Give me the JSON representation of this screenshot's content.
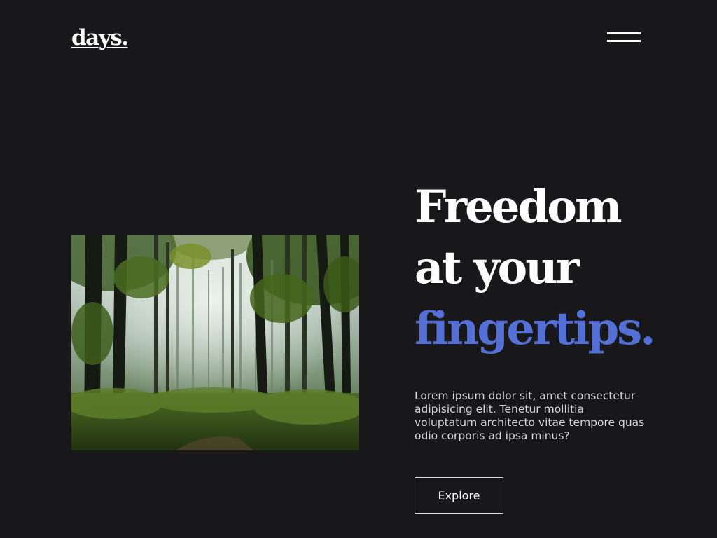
{
  "header": {
    "logo": "days.",
    "menu_icon": "hamburger-menu-icon"
  },
  "hero": {
    "image_alt": "forest",
    "headline": {
      "line1": "Freedom",
      "line2": "at your",
      "line3": "fingertips."
    },
    "description": "Lorem ipsum dolor sit, amet consectetur adipisicing elit. Tenetur mollitia voluptatum architecto vitae tempore quas odio corporis ad ipsa minus?",
    "cta_label": "Explore"
  },
  "colors": {
    "background": "#18181b",
    "text": "#ffffff",
    "accent": "#5470d6"
  }
}
